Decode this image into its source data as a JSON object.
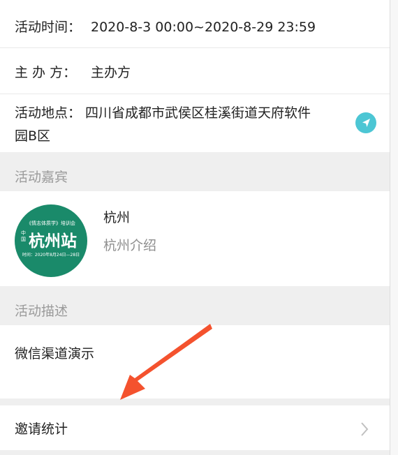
{
  "event": {
    "time_label": "活动时间：",
    "time_value": "2020-8-3 00:00~2020-8-29 23:59",
    "organizer_label": "主 办 方：",
    "organizer_value": "主办方",
    "location_label": "活动地点：",
    "location_line1": "四川省成都市武侯区桂溪街道天府软件",
    "location_line2": "园B区",
    "location_icon": "navigation-icon"
  },
  "guests": {
    "section_title": "活动嘉宾",
    "items": [
      {
        "name": "杭州",
        "intro": "杭州介绍",
        "avatar": {
          "top_text": "《情志体质学》培训会",
          "side_text": "中国",
          "main_text": "杭州站",
          "bottom_text": "时间：2020年8月24日—28日",
          "bg_color": "#1a8a6a"
        }
      }
    ]
  },
  "description": {
    "section_title": "活动描述",
    "content": "微信渠道演示"
  },
  "invite": {
    "label": "邀请统计",
    "icon": "chevron-right-icon"
  },
  "annotation": {
    "arrow_color": "#f4522e"
  },
  "colors": {
    "accent": "#4cc6d4",
    "section_bg": "#efefef"
  }
}
